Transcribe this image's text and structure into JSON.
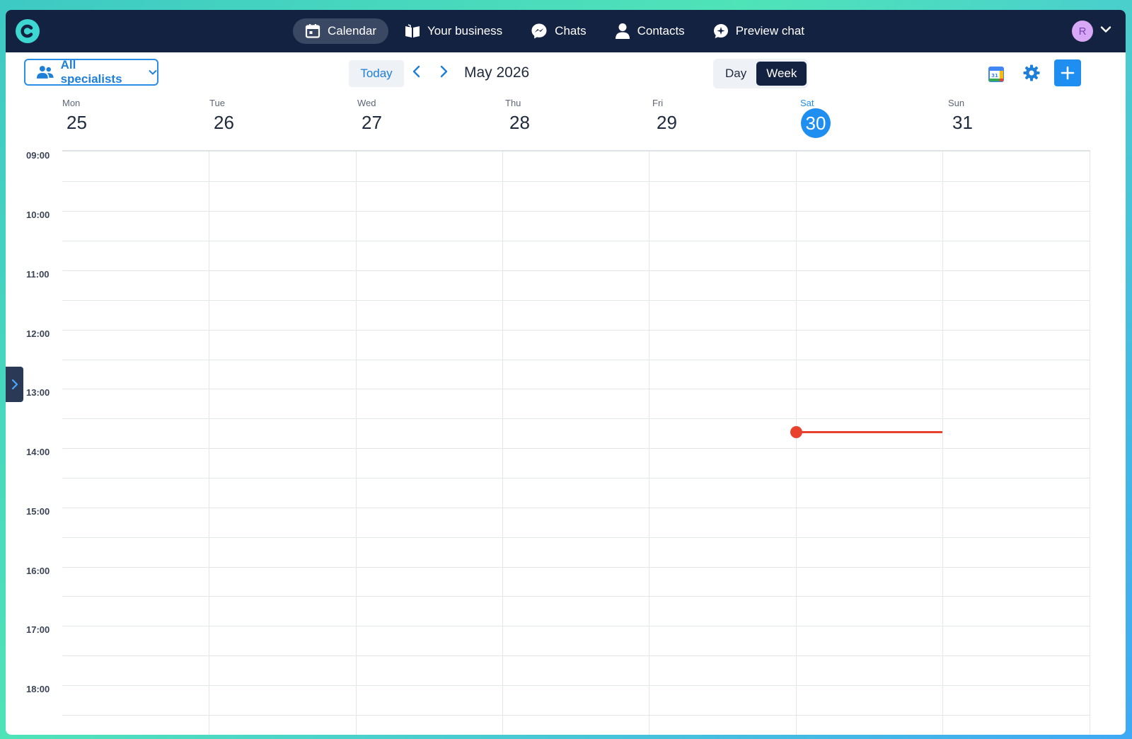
{
  "app": {
    "logo_letter": "C",
    "accent": "#1f8ef1",
    "navbar_bg": "#142241"
  },
  "nav": {
    "items": [
      {
        "label": "Calendar",
        "icon": "calendar-icon",
        "active": true
      },
      {
        "label": "Your business",
        "icon": "book-open-icon",
        "active": false
      },
      {
        "label": "Chats",
        "icon": "messenger-icon",
        "active": false
      },
      {
        "label": "Contacts",
        "icon": "user-icon",
        "active": false
      },
      {
        "label": "Preview chat",
        "icon": "sparkle-chat-icon",
        "active": false
      }
    ]
  },
  "user": {
    "avatar_letter": "R"
  },
  "toolbar": {
    "specialists_label": "All specialists",
    "today_label": "Today",
    "month_label": "May 2026",
    "view_day": "Day",
    "view_week": "Week",
    "active_view": "Week"
  },
  "week": {
    "days": [
      {
        "name": "Mon",
        "num": "25",
        "today": false
      },
      {
        "name": "Tue",
        "num": "26",
        "today": false
      },
      {
        "name": "Wed",
        "num": "27",
        "today": false
      },
      {
        "name": "Thu",
        "num": "28",
        "today": false
      },
      {
        "name": "Fri",
        "num": "29",
        "today": false
      },
      {
        "name": "Sat",
        "num": "30",
        "today": true
      },
      {
        "name": "Sun",
        "num": "31",
        "today": false
      }
    ],
    "hours": [
      "09:00",
      "10:00",
      "11:00",
      "12:00",
      "13:00",
      "14:00",
      "15:00",
      "16:00",
      "17:00",
      "18:00"
    ]
  },
  "now_indicator": {
    "day": "Sat",
    "time": "13:40",
    "color": "#e8422f"
  }
}
